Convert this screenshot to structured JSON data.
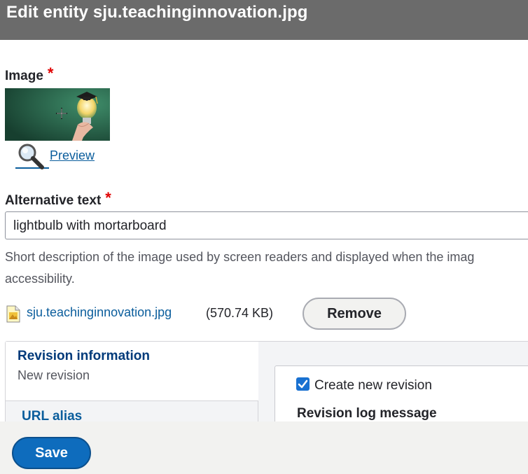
{
  "dialog": {
    "title": "Edit entity sju.teachinginnovation.jpg"
  },
  "image_field": {
    "label": "Image",
    "required_mark": "*",
    "preview_link": "Preview"
  },
  "alt_text": {
    "label": "Alternative text",
    "required_mark": "*",
    "value": "lightbulb with mortarboard",
    "description_line1": "Short description of the image used by screen readers and displayed when the imag",
    "description_line2": "accessibility."
  },
  "file": {
    "name": "sju.teachinginnovation.jpg",
    "size": "(570.74 KB)",
    "remove_label": "Remove"
  },
  "vertical_tabs": {
    "revision_tab": {
      "title": "Revision information",
      "summary": "New revision"
    },
    "url_alias_tab": {
      "title": "URL alias"
    },
    "pane": {
      "checkbox_label": "Create new revision",
      "checkbox_checked": true,
      "log_label": "Revision log message"
    }
  },
  "footer": {
    "save_label": "Save"
  },
  "colors": {
    "link": "#0a5d9c",
    "primary": "#0e6cbd",
    "required": "#e00000",
    "titlebar": "#6b6b6b"
  },
  "icons": [
    "magnifier-icon",
    "file-image-icon",
    "checkmark-icon"
  ]
}
